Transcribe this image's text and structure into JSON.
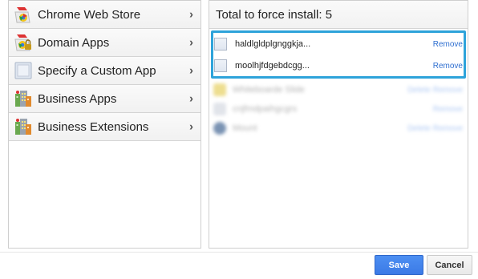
{
  "categories": [
    {
      "label": "Chrome Web Store",
      "icon": "chrome-web-store-icon"
    },
    {
      "label": "Domain Apps",
      "icon": "domain-apps-icon"
    },
    {
      "label": "Specify a Custom App",
      "icon": "custom-app-icon"
    },
    {
      "label": "Business Apps",
      "icon": "business-apps-icon"
    },
    {
      "label": "Business Extensions",
      "icon": "business-extensions-icon"
    }
  ],
  "right_panel": {
    "header": "Total to force install: 5",
    "apps": [
      {
        "name": "haldlgldplgnggkja...",
        "action": "Remove"
      },
      {
        "name": "moolhjfdgebdcgg...",
        "action": "Remove"
      }
    ],
    "blurred_apps": [
      {
        "name": "Whiteboarde Slide",
        "action": "Delete Remove"
      },
      {
        "name": "cnjfmdpaihgcgrs",
        "action": "Remove"
      },
      {
        "name": "Mount",
        "action": "Delete Remove"
      }
    ]
  },
  "buttons": {
    "save": "Save",
    "cancel": "Cancel"
  },
  "colors": {
    "highlight": "#2ea3da",
    "save_button": "#3b7ae6",
    "link": "#2f6fd0"
  }
}
